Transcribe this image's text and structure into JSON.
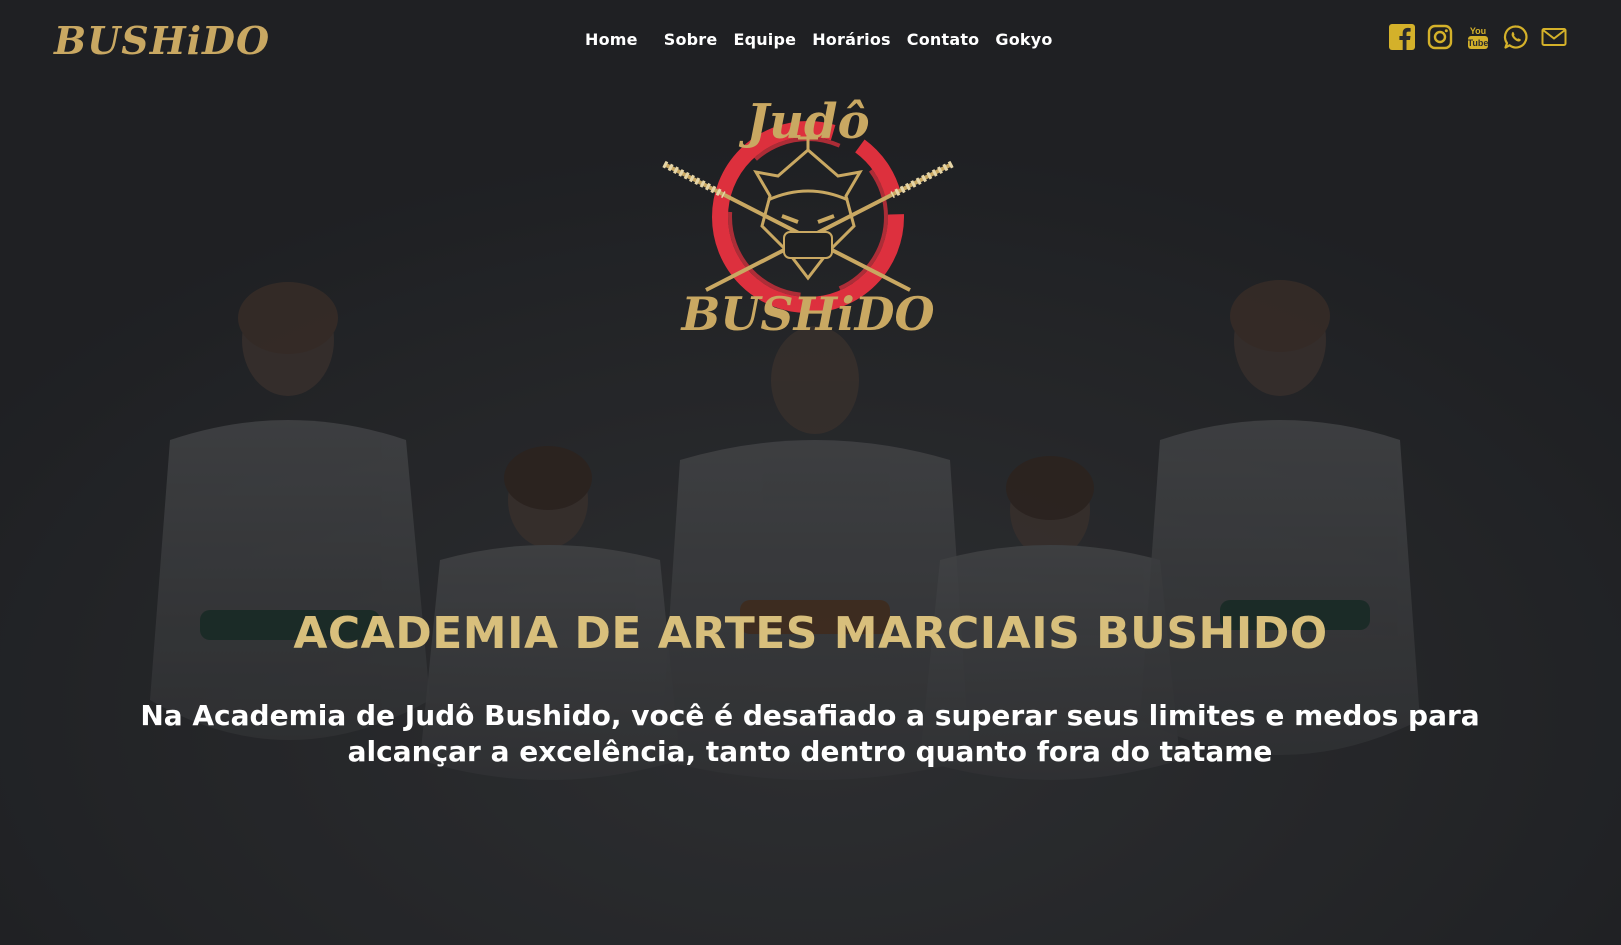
{
  "brand": {
    "name": "BUSHiDO"
  },
  "nav": {
    "items": [
      {
        "label": "Home"
      },
      {
        "label": "Sobre"
      },
      {
        "label": "Equipe"
      },
      {
        "label": "Horários"
      },
      {
        "label": "Contato"
      },
      {
        "label": "Gokyo"
      }
    ]
  },
  "social": [
    {
      "icon": "facebook-icon"
    },
    {
      "icon": "instagram-icon"
    },
    {
      "icon": "youtube-icon"
    },
    {
      "icon": "whatsapp-icon"
    },
    {
      "icon": "email-icon"
    }
  ],
  "logo": {
    "top_text": "Judô",
    "bottom_text": "BUSHiDO"
  },
  "hero": {
    "title": "ACADEMIA DE ARTES MARCIAIS BUSHIDO",
    "subtitle": "Na Academia de Judô Bushido, você é desafiado a superar seus limites e medos para alcançar a excelência, tanto dentro quanto fora do tatame"
  },
  "colors": {
    "gold": "#c9a862",
    "title_gold": "#d8bf7c",
    "icon_yellow": "#d4b12a",
    "logo_red": "#e8323f",
    "background": "#2b2d2f"
  }
}
